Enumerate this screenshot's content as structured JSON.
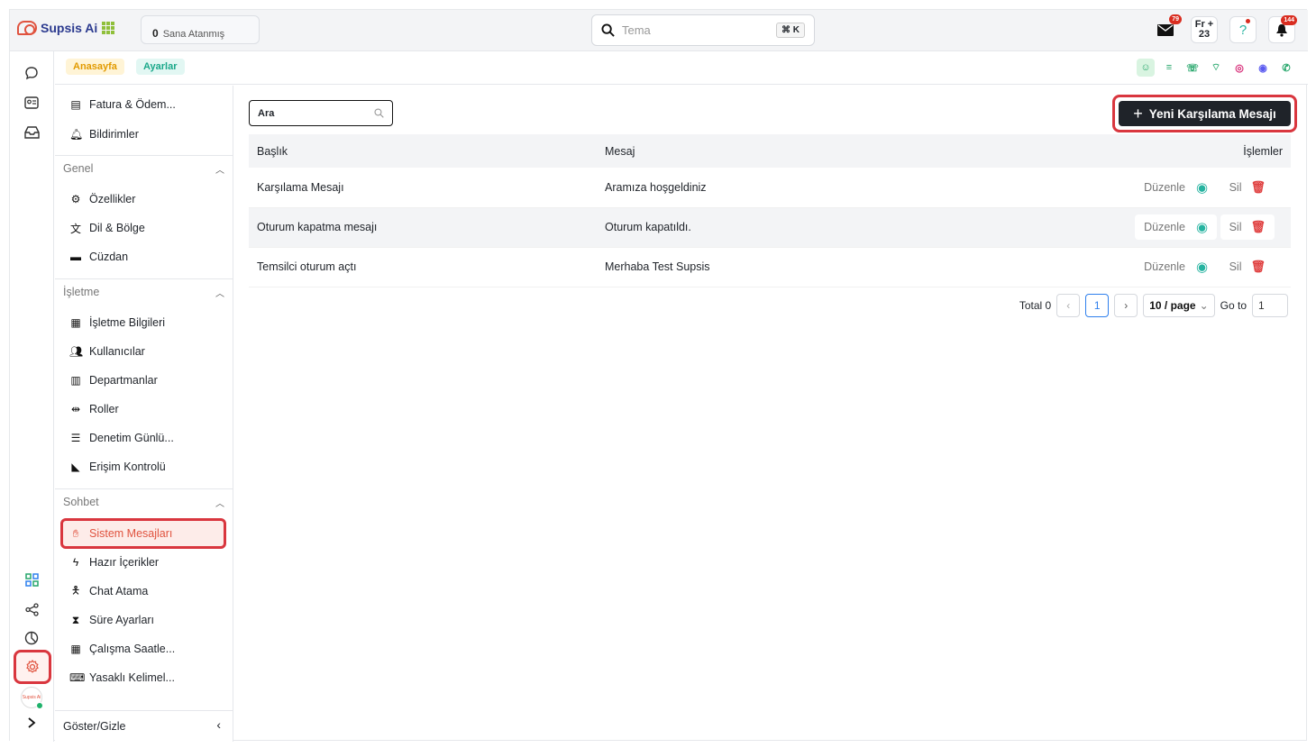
{
  "app": {
    "name": "Supsis Ai"
  },
  "topbar": {
    "assigned_count": "0",
    "assigned_label": "Sana Atanmış",
    "search_placeholder": "Tema",
    "search_shortcut": "⌘ K",
    "mail_badge": "79",
    "date_day": "Fr",
    "date_num": "23",
    "help_label": "?",
    "bell_badge": "144"
  },
  "breadcrumb": {
    "home": "Anasayfa",
    "settings": "Ayarlar"
  },
  "sidebar": {
    "top_items": [
      {
        "label": "Fatura & Ödem...",
        "icon": "invoice-icon"
      },
      {
        "label": "Bildirimler",
        "icon": "bell-icon"
      }
    ],
    "groups": [
      {
        "title": "Genel",
        "items": [
          {
            "label": "Özellikler",
            "icon": "gear-icon"
          },
          {
            "label": "Dil & Bölge",
            "icon": "translate-icon"
          },
          {
            "label": "Cüzdan",
            "icon": "wallet-icon"
          }
        ]
      },
      {
        "title": "İşletme",
        "items": [
          {
            "label": "İşletme Bilgileri",
            "icon": "building-icon"
          },
          {
            "label": "Kullanıcılar",
            "icon": "users-icon"
          },
          {
            "label": "Departmanlar",
            "icon": "department-icon"
          },
          {
            "label": "Roller",
            "icon": "roles-icon"
          },
          {
            "label": "Denetim Günlü...",
            "icon": "list-icon"
          },
          {
            "label": "Erişim Kontrolü",
            "icon": "shield-icon"
          }
        ]
      },
      {
        "title": "Sohbet",
        "items": [
          {
            "label": "Sistem Mesajları",
            "icon": "wave-icon",
            "active": true
          },
          {
            "label": "Hazır İçerikler",
            "icon": "bolt-icon"
          },
          {
            "label": "Chat Atama",
            "icon": "person-icon"
          },
          {
            "label": "Süre Ayarları",
            "icon": "hourglass-icon"
          },
          {
            "label": "Çalışma Saatle...",
            "icon": "calendar-icon"
          },
          {
            "label": "Yasaklı Kelimel...",
            "icon": "keyboard-icon"
          }
        ]
      }
    ],
    "footer_label": "Göster/Gizle"
  },
  "main": {
    "search_value": "Ara",
    "new_button_label": "Yeni Karşılama Mesajı",
    "columns": [
      "Başlık",
      "Mesaj",
      "İşlemler"
    ],
    "rows": [
      {
        "title": "Karşılama Mesajı",
        "message": "Aramıza hoşgeldiniz"
      },
      {
        "title": "Oturum kapatma mesajı",
        "message": "Oturum kapatıldı."
      },
      {
        "title": "Temsilci oturum açtı",
        "message": "Merhaba Test Supsis"
      }
    ],
    "action_edit": "Düzenle",
    "action_delete": "Sil"
  },
  "pagination": {
    "total_label": "Total 0",
    "current_page": "1",
    "page_size": "10 / page",
    "goto_label": "Go to",
    "goto_value": "1"
  },
  "colors": {
    "accent": "#1f2329",
    "highlight": "#d9363e",
    "teal": "#26b3a0"
  }
}
